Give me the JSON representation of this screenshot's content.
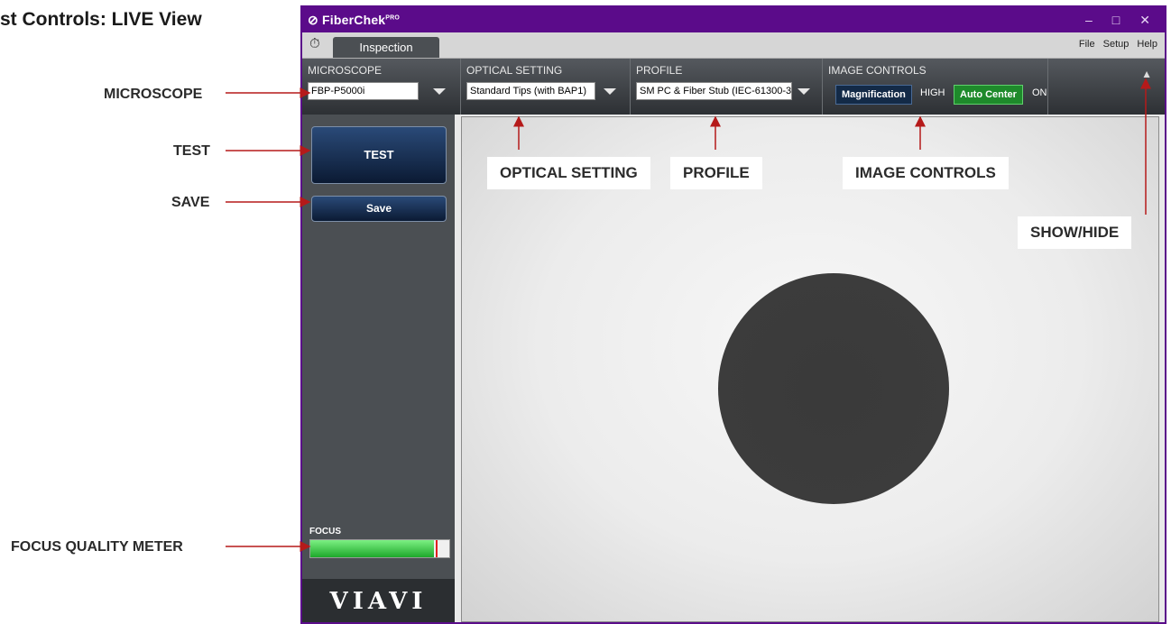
{
  "heading": "st Controls: LIVE  View",
  "annotations": {
    "microscope": "MICROSCOPE",
    "test": "TEST",
    "save": "SAVE",
    "focus_meter": "FOCUS QUALITY METER",
    "optical_setting": "OPTICAL SETTING",
    "profile": "PROFILE",
    "image_controls": "IMAGE CONTROLS",
    "show_hide": "SHOW/HIDE"
  },
  "app": {
    "brand": "FiberChek",
    "brand_sup": "PRO",
    "window_controls": [
      "–",
      "□",
      "✕"
    ],
    "tab_icon": "stopwatch-icon",
    "tab_label": "Inspection",
    "menu": [
      "File",
      "Setup",
      "Help"
    ]
  },
  "controls": {
    "microscope": {
      "title": "MICROSCOPE",
      "value": "FBP-P5000i"
    },
    "optical_setting": {
      "title": "OPTICAL SETTING",
      "value": "Standard Tips (with BAP1)"
    },
    "profile": {
      "title": "PROFILE",
      "value": "SM PC & Fiber Stub (IEC-61300-3"
    },
    "image_controls": {
      "title": "IMAGE CONTROLS",
      "magnification_label": "Magnification",
      "magnification_value": "HIGH",
      "auto_center_label": "Auto Center",
      "auto_center_value": "ON"
    },
    "show_hide_icon": "chevron-up-icon"
  },
  "sidebar": {
    "test_label": "TEST",
    "save_label": "Save",
    "focus_label": "FOCUS",
    "focus_level": 0.89,
    "logo": "VIAVI"
  },
  "colors": {
    "titlebar": "#5b0b8a",
    "annotation_arrow": "#b51a1a",
    "auto_center": "#1e8a2b",
    "magnification": "#132a47"
  }
}
